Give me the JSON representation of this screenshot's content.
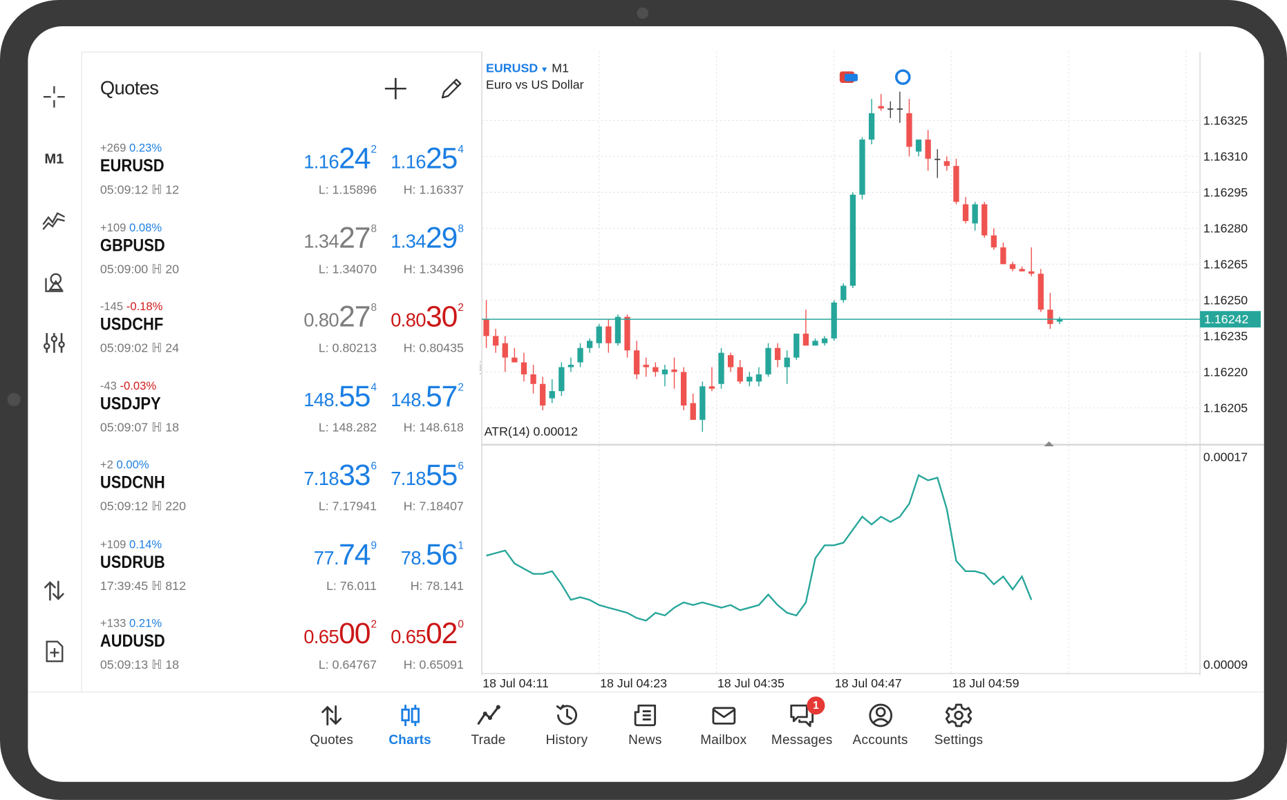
{
  "toolbar": {
    "timeframe": "M1"
  },
  "quotes_panel": {
    "title": "Quotes",
    "rows": [
      {
        "change_points": "+269",
        "change_pct": "0.23%",
        "direction": "up",
        "symbol": "EURUSD",
        "time": "05:09:12",
        "spread": "12",
        "bid": {
          "small": "1.16",
          "big": "24",
          "sup": "2",
          "color": "blue"
        },
        "ask": {
          "small": "1.16",
          "big": "25",
          "sup": "4",
          "color": "blue"
        },
        "low": "L: 1.15896",
        "high": "H: 1.16337"
      },
      {
        "change_points": "+109",
        "change_pct": "0.08%",
        "direction": "up",
        "symbol": "GBPUSD",
        "time": "05:09:00",
        "spread": "20",
        "bid": {
          "small": "1.34",
          "big": "27",
          "sup": "8",
          "color": "gray"
        },
        "ask": {
          "small": "1.34",
          "big": "29",
          "sup": "8",
          "color": "blue"
        },
        "low": "L: 1.34070",
        "high": "H: 1.34396"
      },
      {
        "change_points": "-145",
        "change_pct": "-0.18%",
        "direction": "down",
        "symbol": "USDCHF",
        "time": "05:09:02",
        "spread": "24",
        "bid": {
          "small": "0.80",
          "big": "27",
          "sup": "8",
          "color": "gray"
        },
        "ask": {
          "small": "0.80",
          "big": "30",
          "sup": "2",
          "color": "red"
        },
        "low": "L: 0.80213",
        "high": "H: 0.80435"
      },
      {
        "change_points": "-43",
        "change_pct": "-0.03%",
        "direction": "down",
        "symbol": "USDJPY",
        "time": "05:09:07",
        "spread": "18",
        "bid": {
          "small": "148.",
          "big": "55",
          "sup": "4",
          "color": "blue"
        },
        "ask": {
          "small": "148.",
          "big": "57",
          "sup": "2",
          "color": "blue"
        },
        "low": "L: 148.282",
        "high": "H: 148.618"
      },
      {
        "change_points": "+2",
        "change_pct": "0.00%",
        "direction": "up",
        "symbol": "USDCNH",
        "time": "05:09:12",
        "spread": "220",
        "bid": {
          "small": "7.18",
          "big": "33",
          "sup": "6",
          "color": "blue"
        },
        "ask": {
          "small": "7.18",
          "big": "55",
          "sup": "6",
          "color": "blue"
        },
        "low": "L: 7.17941",
        "high": "H: 7.18407"
      },
      {
        "change_points": "+109",
        "change_pct": "0.14%",
        "direction": "up",
        "symbol": "USDRUB",
        "time": "17:39:45",
        "spread": "812",
        "bid": {
          "small": "77.",
          "big": "74",
          "sup": "9",
          "color": "blue"
        },
        "ask": {
          "small": "78.",
          "big": "56",
          "sup": "1",
          "color": "blue"
        },
        "low": "L: 76.011",
        "high": "H: 78.141"
      },
      {
        "change_points": "+133",
        "change_pct": "0.21%",
        "direction": "up",
        "symbol": "AUDUSD",
        "time": "05:09:13",
        "spread": "18",
        "bid": {
          "small": "0.65",
          "big": "00",
          "sup": "2",
          "color": "red"
        },
        "ask": {
          "small": "0.65",
          "big": "02",
          "sup": "0",
          "color": "red"
        },
        "low": "L: 0.64767",
        "high": "H: 0.65091"
      }
    ]
  },
  "chart": {
    "symbol": "EURUSD",
    "timeframe": "M1",
    "description": "Euro vs US Dollar",
    "indicator_label": "ATR(14) 0.00012",
    "colors": {
      "bull": "#26a69a",
      "bear": "#ef5350",
      "line": "#26a69a",
      "current_price_bg": "#26a69a",
      "grid": "#e3e3e3"
    }
  },
  "chart_data": {
    "type": "candlestick",
    "price_axis_ticks": [
      "1.16325",
      "1.16310",
      "1.16295",
      "1.16280",
      "1.16265",
      "1.16250",
      "1.16235",
      "1.16220",
      "1.16205"
    ],
    "current_price": "1.16242",
    "ylim": [
      1.1619,
      1.1634
    ],
    "time_axis_ticks": [
      "18 Jul 04:11",
      "18 Jul 04:23",
      "18 Jul 04:35",
      "18 Jul 04:47",
      "18 Jul 04:59"
    ],
    "candles": [
      [
        1.16242,
        1.1625,
        1.1623,
        1.16235
      ],
      [
        1.16235,
        1.16238,
        1.16228,
        1.16231
      ],
      [
        1.16232,
        1.16235,
        1.1622,
        1.16226
      ],
      [
        1.16226,
        1.1623,
        1.16224,
        1.16224
      ],
      [
        1.16224,
        1.16228,
        1.16216,
        1.16219
      ],
      [
        1.16219,
        1.16223,
        1.16211,
        1.16215
      ],
      [
        1.16215,
        1.16218,
        1.16204,
        1.16206
      ],
      [
        1.16209,
        1.16217,
        1.16207,
        1.16212
      ],
      [
        1.16212,
        1.16224,
        1.1621,
        1.16222
      ],
      [
        1.16222,
        1.16226,
        1.1622,
        1.16223
      ],
      [
        1.16224,
        1.16232,
        1.16222,
        1.1623
      ],
      [
        1.1623,
        1.16234,
        1.16228,
        1.16233
      ],
      [
        1.16232,
        1.1624,
        1.1623,
        1.16239
      ],
      [
        1.16239,
        1.16242,
        1.16228,
        1.16232
      ],
      [
        1.16232,
        1.16244,
        1.16231,
        1.16243
      ],
      [
        1.16243,
        1.16244,
        1.16226,
        1.16229
      ],
      [
        1.16229,
        1.16233,
        1.16217,
        1.16219
      ],
      [
        1.16223,
        1.16226,
        1.16218,
        1.16222
      ],
      [
        1.16222,
        1.16224,
        1.16218,
        1.1622
      ],
      [
        1.16219,
        1.16223,
        1.16214,
        1.16221
      ],
      [
        1.16221,
        1.16226,
        1.16213,
        1.1622
      ],
      [
        1.1622,
        1.16222,
        1.16204,
        1.16206
      ],
      [
        1.16207,
        1.16211,
        1.162,
        1.162
      ],
      [
        1.162,
        1.16216,
        1.16195,
        1.16214
      ],
      [
        1.16214,
        1.16222,
        1.16212,
        1.16213
      ],
      [
        1.16215,
        1.1623,
        1.16213,
        1.16228
      ],
      [
        1.16227,
        1.16228,
        1.1622,
        1.16222
      ],
      [
        1.16222,
        1.16225,
        1.16215,
        1.16216
      ],
      [
        1.16216,
        1.1622,
        1.16214,
        1.16218
      ],
      [
        1.16216,
        1.16222,
        1.16214,
        1.16219
      ],
      [
        1.16219,
        1.16232,
        1.16218,
        1.1623
      ],
      [
        1.1623,
        1.16232,
        1.16222,
        1.16225
      ],
      [
        1.16222,
        1.16229,
        1.16215,
        1.16226
      ],
      [
        1.16226,
        1.16236,
        1.16225,
        1.16236
      ],
      [
        1.16236,
        1.16246,
        1.16232,
        1.16231
      ],
      [
        1.16231,
        1.16234,
        1.16232,
        1.16233
      ],
      [
        1.16232,
        1.16235,
        1.16231,
        1.16234
      ],
      [
        1.16234,
        1.1625,
        1.16233,
        1.16249
      ],
      [
        1.1625,
        1.16257,
        1.16249,
        1.16256
      ],
      [
        1.16256,
        1.16295,
        1.16255,
        1.16294
      ],
      [
        1.16294,
        1.16318,
        1.16292,
        1.16317
      ],
      [
        1.16317,
        1.16334,
        1.16315,
        1.16328
      ],
      [
        1.16331,
        1.16336,
        1.16329,
        1.1633
      ],
      [
        1.1633,
        1.16333,
        1.16326,
        1.1633
      ],
      [
        1.1633,
        1.16337,
        1.16324,
        1.1633
      ],
      [
        1.16328,
        1.16334,
        1.1631,
        1.16314
      ],
      [
        1.16312,
        1.16317,
        1.1631,
        1.16317
      ],
      [
        1.16317,
        1.16321,
        1.16304,
        1.16309
      ],
      [
        1.16309,
        1.16313,
        1.16301,
        1.16309
      ],
      [
        1.16308,
        1.1631,
        1.16304,
        1.16306
      ],
      [
        1.16306,
        1.16309,
        1.1629,
        1.16291
      ],
      [
        1.1629,
        1.16293,
        1.16282,
        1.16283
      ],
      [
        1.16282,
        1.16291,
        1.16279,
        1.1629
      ],
      [
        1.1629,
        1.16291,
        1.16276,
        1.16277
      ],
      [
        1.16277,
        1.1628,
        1.16271,
        1.16272
      ],
      [
        1.16272,
        1.16274,
        1.16265,
        1.16265
      ],
      [
        1.16265,
        1.16266,
        1.16262,
        1.16263
      ],
      [
        1.16263,
        1.16264,
        1.16262,
        1.16262
      ],
      [
        1.16262,
        1.16272,
        1.1626,
        1.16261
      ],
      [
        1.16261,
        1.16263,
        1.16245,
        1.16246
      ],
      [
        1.16246,
        1.16253,
        1.16238,
        1.1624
      ],
      [
        1.16241,
        1.16243,
        1.1624,
        1.16242
      ]
    ],
    "atr_axis_ticks": [
      "0.00017",
      "0.00009"
    ],
    "atr_ylim": [
      8e-05,
      0.00017
    ],
    "atr_values": [
      0.000132,
      0.000133,
      0.000134,
      0.000129,
      0.000127,
      0.000125,
      0.000125,
      0.000126,
      0.000121,
      0.000115,
      0.000116,
      0.000115,
      0.000113,
      0.000112,
      0.000111,
      0.00011,
      0.000108,
      0.000107,
      0.00011,
      0.000109,
      0.000112,
      0.000114,
      0.000113,
      0.000114,
      0.000113,
      0.000112,
      0.000113,
      0.000111,
      0.000112,
      0.000113,
      0.000117,
      0.000113,
      0.00011,
      0.000109,
      0.000114,
      0.000131,
      0.000136,
      0.000136,
      0.000137,
      0.000142,
      0.000147,
      0.000144,
      0.000147,
      0.000145,
      0.000147,
      0.000152,
      0.000163,
      0.000161,
      0.000162,
      0.00015,
      0.00013,
      0.000126,
      0.000126,
      0.000125,
      0.000121,
      0.000124,
      0.000119,
      0.000124,
      0.000115
    ]
  },
  "navbar": {
    "items": [
      {
        "label": "Quotes",
        "icon": "quotes-arrows-icon",
        "active": false
      },
      {
        "label": "Charts",
        "icon": "candlestick-chart-icon",
        "active": true
      },
      {
        "label": "Trade",
        "icon": "trade-line-icon",
        "active": false
      },
      {
        "label": "History",
        "icon": "history-clock-icon",
        "active": false
      },
      {
        "label": "News",
        "icon": "news-icon",
        "active": false
      },
      {
        "label": "Mailbox",
        "icon": "mail-envelope-icon",
        "active": false
      },
      {
        "label": "Messages",
        "icon": "messages-bubble-icon",
        "active": false,
        "badge": "1"
      },
      {
        "label": "Accounts",
        "icon": "accounts-person-icon",
        "active": false
      },
      {
        "label": "Settings",
        "icon": "settings-gear-icon",
        "active": false
      }
    ]
  }
}
